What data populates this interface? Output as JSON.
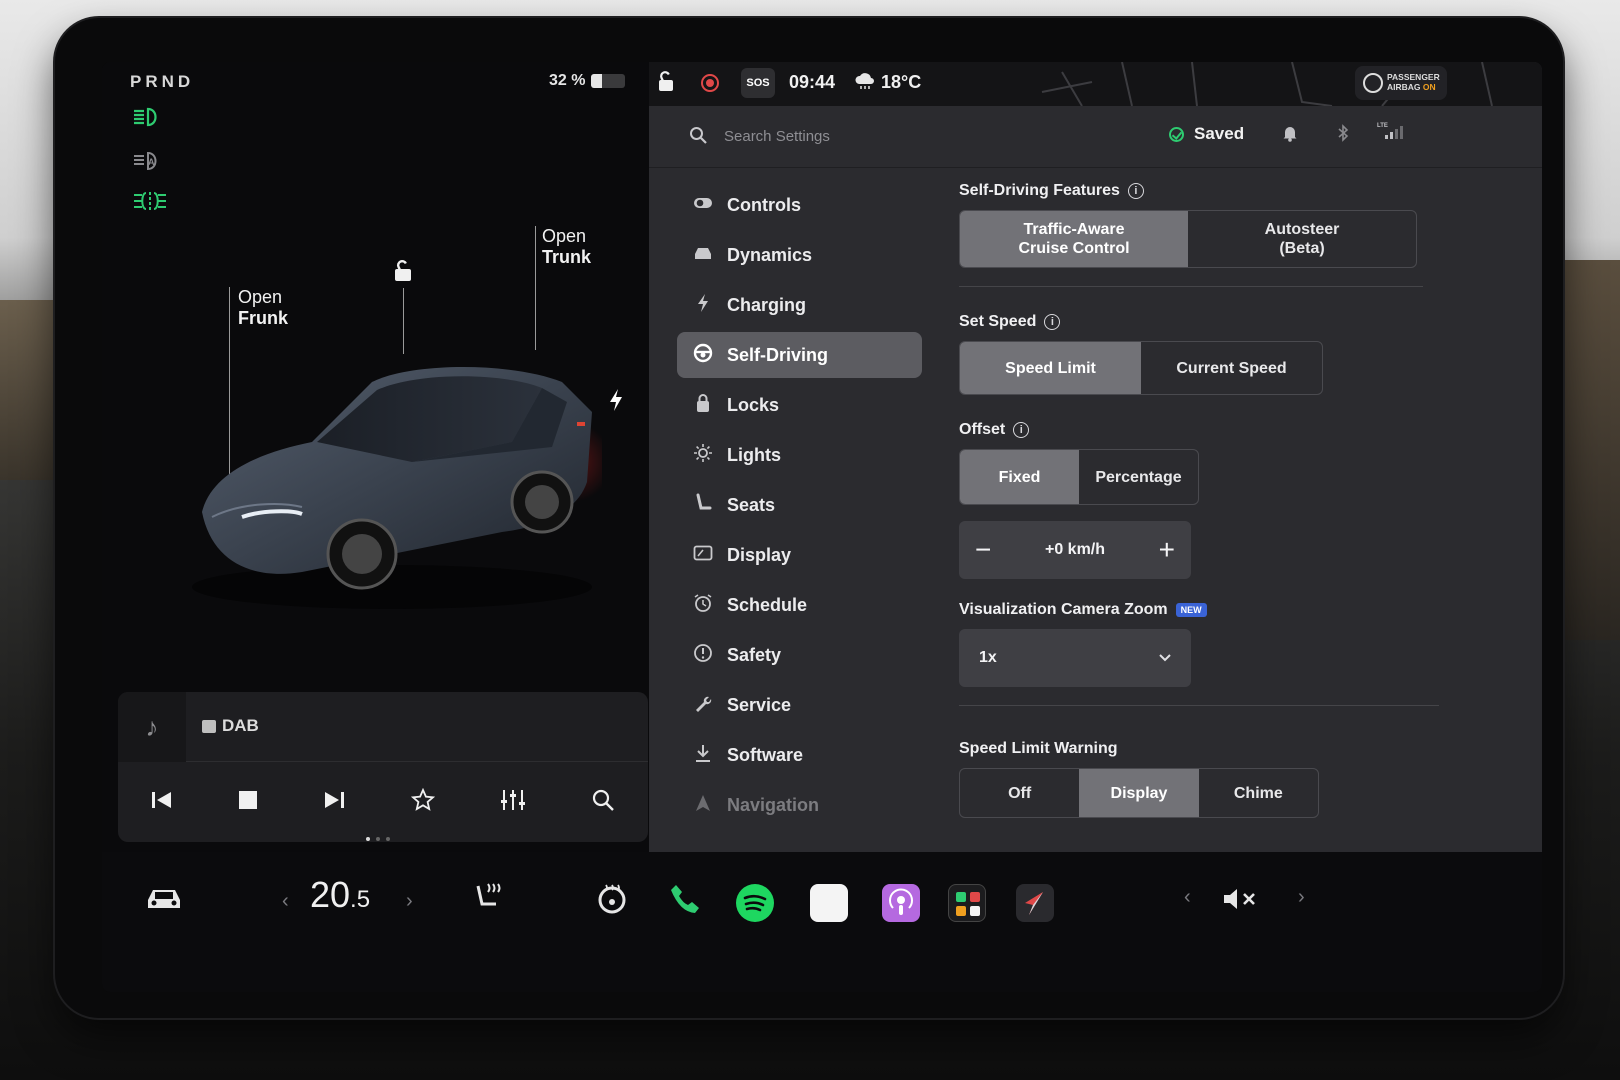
{
  "vehicle": {
    "gear": "PRND",
    "battery_percent": "32 %",
    "battery_level": 0.32,
    "callouts": {
      "frunk_line1": "Open",
      "frunk_line2": "Frunk",
      "trunk_line1": "Open",
      "trunk_line2": "Trunk"
    },
    "indicators": [
      "headlights-on-icon",
      "auto-headlights-icon",
      "fog-lights-icon"
    ]
  },
  "media": {
    "source": "DAB",
    "controls": [
      "previous-icon",
      "stop-icon",
      "next-icon",
      "favorite-icon",
      "equalizer-icon",
      "search-icon"
    ]
  },
  "status_bar": {
    "sos": "SOS",
    "time": "09:44",
    "temperature": "18°C",
    "airbag_line1": "PASSENGER",
    "airbag_line2": "AIRBAG",
    "airbag_state": "ON"
  },
  "settings": {
    "search_placeholder": "Search Settings",
    "saved_label": "Saved",
    "nav": [
      {
        "label": "Controls",
        "icon": "toggle-icon"
      },
      {
        "label": "Dynamics",
        "icon": "car-icon"
      },
      {
        "label": "Charging",
        "icon": "bolt-icon"
      },
      {
        "label": "Self-Driving",
        "icon": "steering-wheel-icon",
        "active": true
      },
      {
        "label": "Locks",
        "icon": "lock-icon"
      },
      {
        "label": "Lights",
        "icon": "sun-icon"
      },
      {
        "label": "Seats",
        "icon": "seat-icon"
      },
      {
        "label": "Display",
        "icon": "display-icon"
      },
      {
        "label": "Schedule",
        "icon": "alarm-clock-icon"
      },
      {
        "label": "Safety",
        "icon": "alert-icon"
      },
      {
        "label": "Service",
        "icon": "wrench-icon"
      },
      {
        "label": "Software",
        "icon": "download-icon"
      },
      {
        "label": "Navigation",
        "icon": "navigation-arrow-icon"
      }
    ],
    "self_driving_features": {
      "label": "Self-Driving Features",
      "option1_line1": "Traffic-Aware",
      "option1_line2": "Cruise Control",
      "option2_line1": "Autosteer",
      "option2_line2": "(Beta)",
      "selected": "option1"
    },
    "set_speed": {
      "label": "Set Speed",
      "options": [
        "Speed Limit",
        "Current Speed"
      ],
      "selected": "Speed Limit"
    },
    "offset": {
      "label": "Offset",
      "options": [
        "Fixed",
        "Percentage"
      ],
      "selected": "Fixed",
      "value": "+0 km/h",
      "minus": "−",
      "plus": "+"
    },
    "camera_zoom": {
      "label": "Visualization Camera Zoom",
      "badge": "NEW",
      "value": "1x"
    },
    "speed_limit_warning": {
      "label": "Speed Limit Warning",
      "options": [
        "Off",
        "Display",
        "Chime"
      ],
      "selected": "Display"
    }
  },
  "dock": {
    "cabin_temp_whole": "20",
    "cabin_temp_decimal": ".5",
    "apps": [
      "car-icon",
      "seat-heater-icon",
      "steering-wheel-heat-icon",
      "phone-icon",
      "spotify-icon",
      "calendar-icon",
      "podcasts-icon",
      "toybox-icon",
      "navigation-icon"
    ],
    "volume_state": "muted"
  },
  "colors": {
    "accent_green": "#2ecc71",
    "record_red": "#e04848",
    "selected_segment": "#727277",
    "new_badge": "#3a63d6",
    "airbag_on": "#f0a020"
  }
}
